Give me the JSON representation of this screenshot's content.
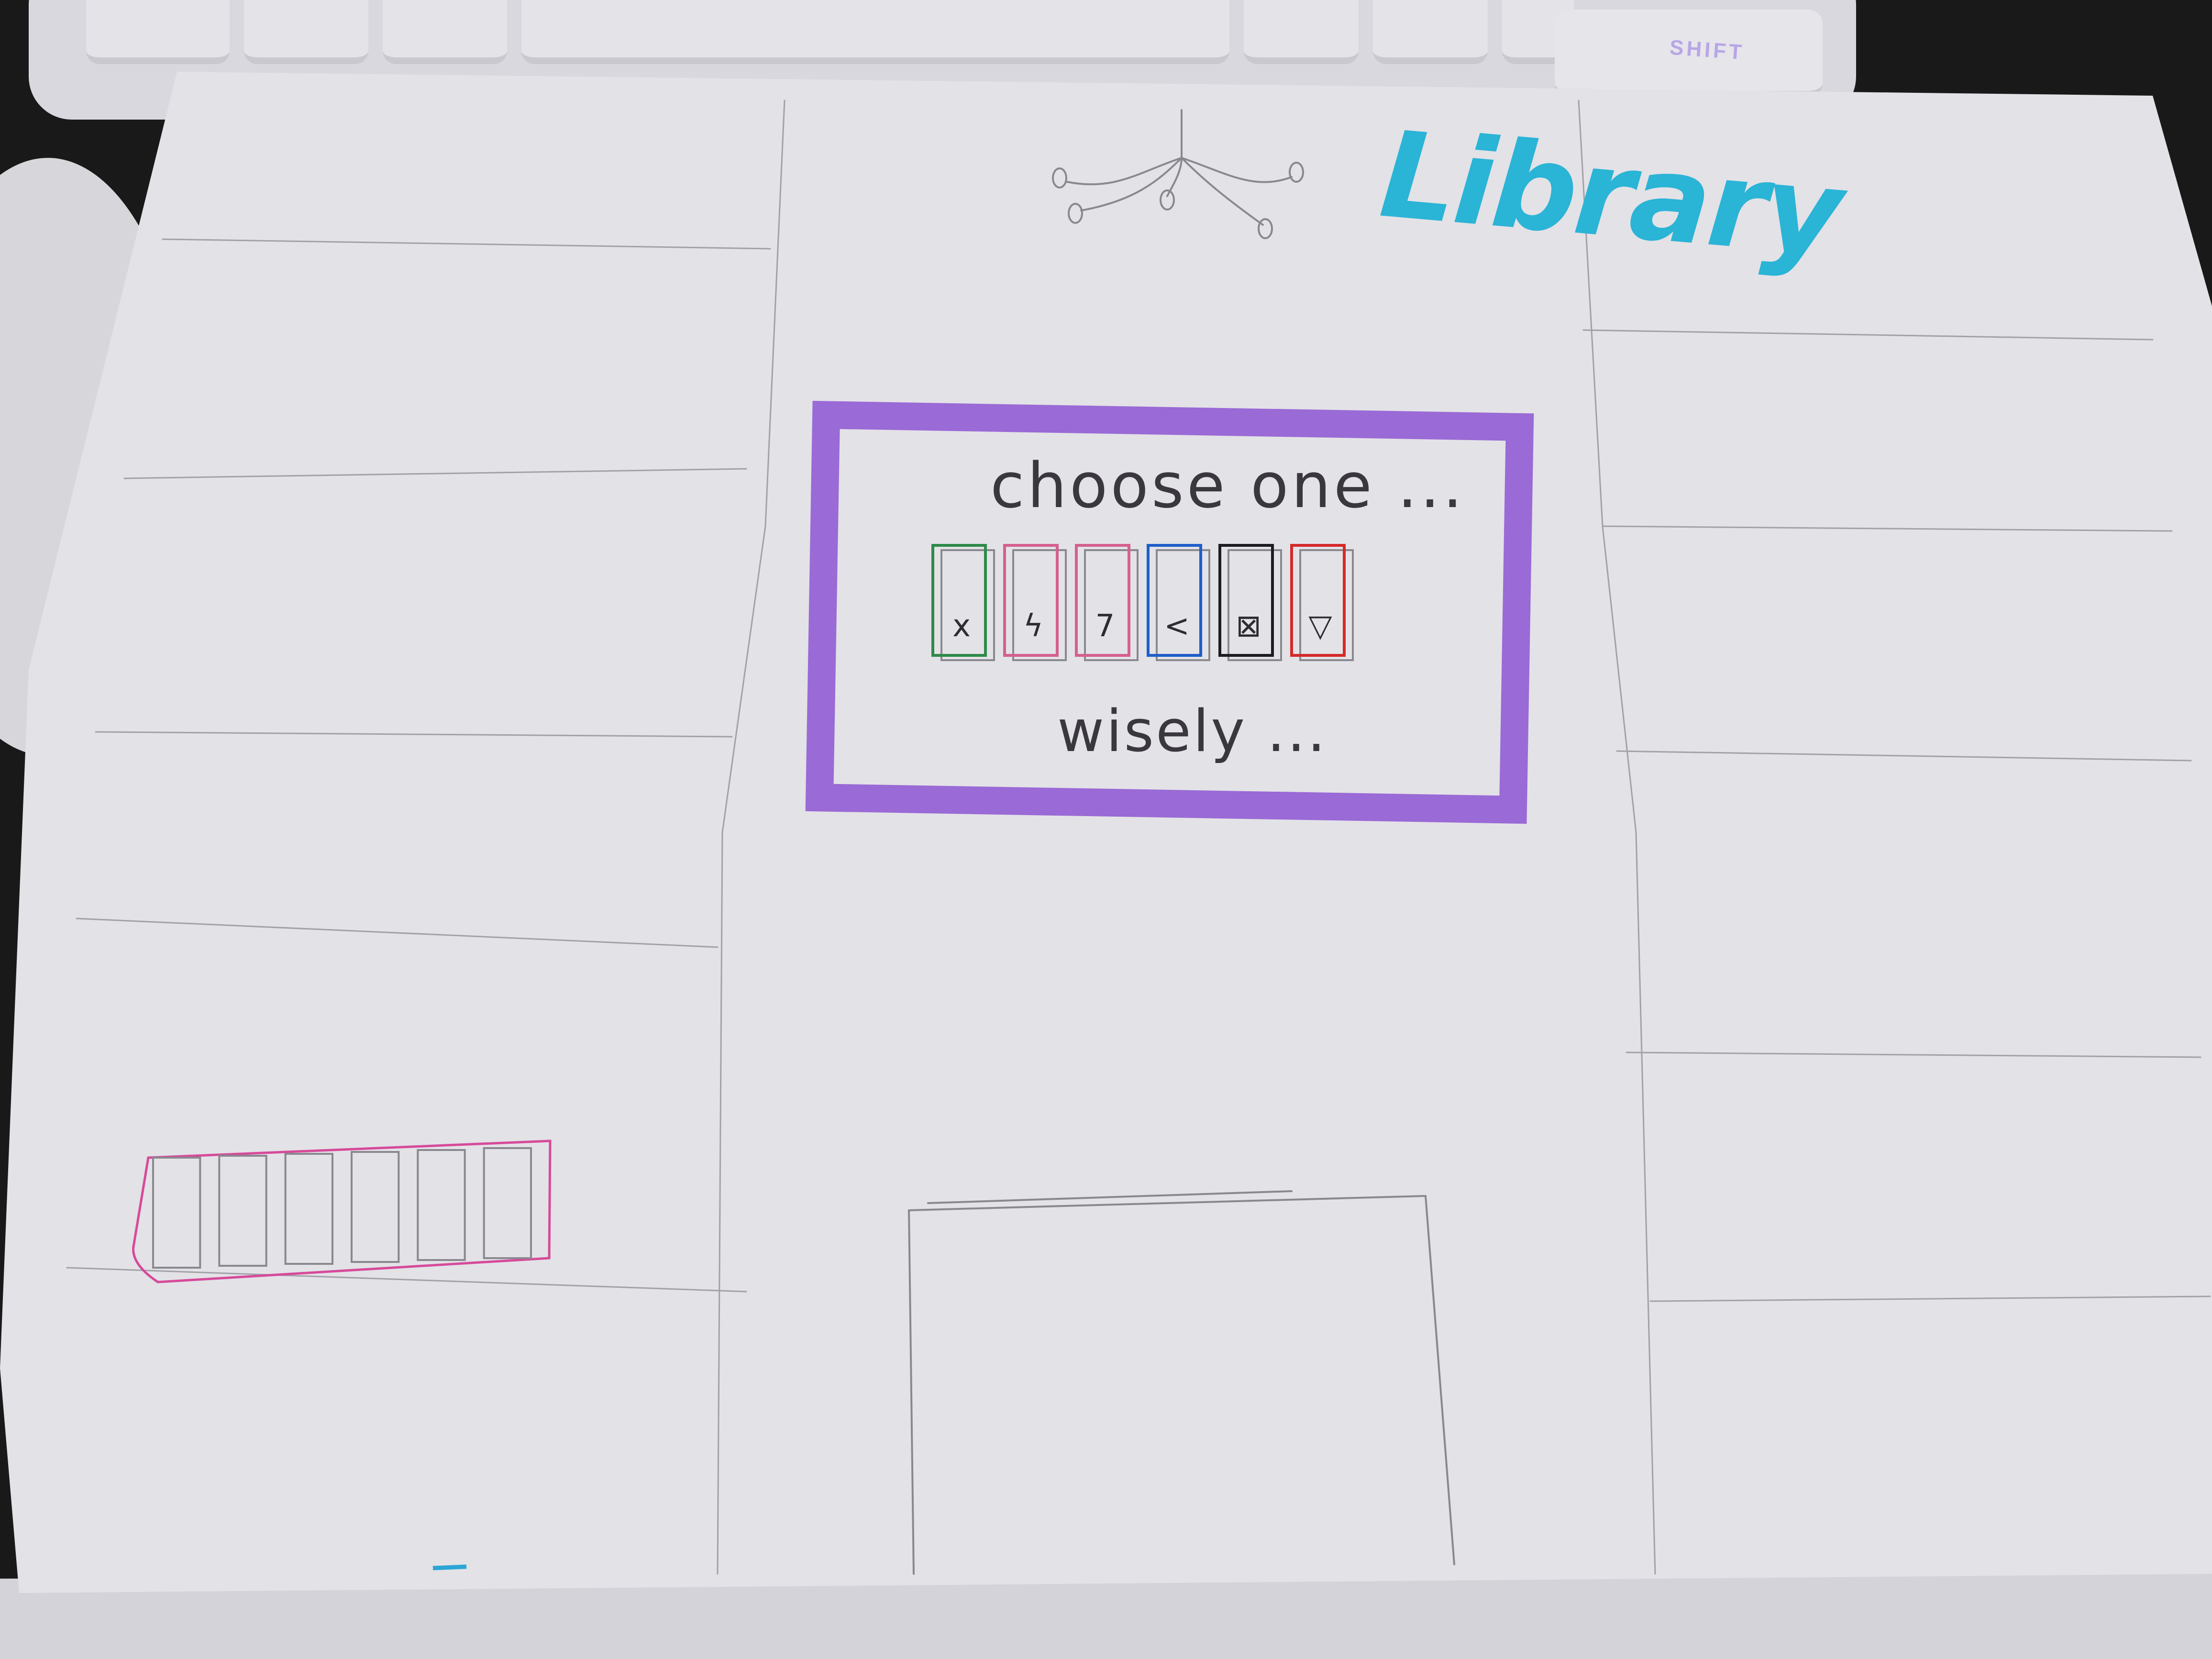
{
  "sketch": {
    "title": "Library",
    "dialog": {
      "heading": "choose one ...",
      "footer": "wisely ...",
      "frame_color": "#9a6ad6",
      "cards": [
        {
          "color": "#2f8a4a",
          "glyph": "x"
        },
        {
          "color": "#d4608f",
          "glyph": "ϟ"
        },
        {
          "color": "#d4608f",
          "glyph": "7"
        },
        {
          "color": "#1e5fc9",
          "glyph": "<"
        },
        {
          "color": "#1d1c20",
          "glyph": "⊠"
        },
        {
          "color": "#d42a2a",
          "glyph": "▽"
        }
      ]
    },
    "hand_row": {
      "color": "#d64a9a",
      "slot_count": 6
    },
    "keyboard_key_label": "SHIFT",
    "icons": [
      "chandelier-icon"
    ],
    "colors": {
      "title": "#2ab4d6",
      "pencil": "#8a888f",
      "paper": "#e3e2e7"
    }
  }
}
